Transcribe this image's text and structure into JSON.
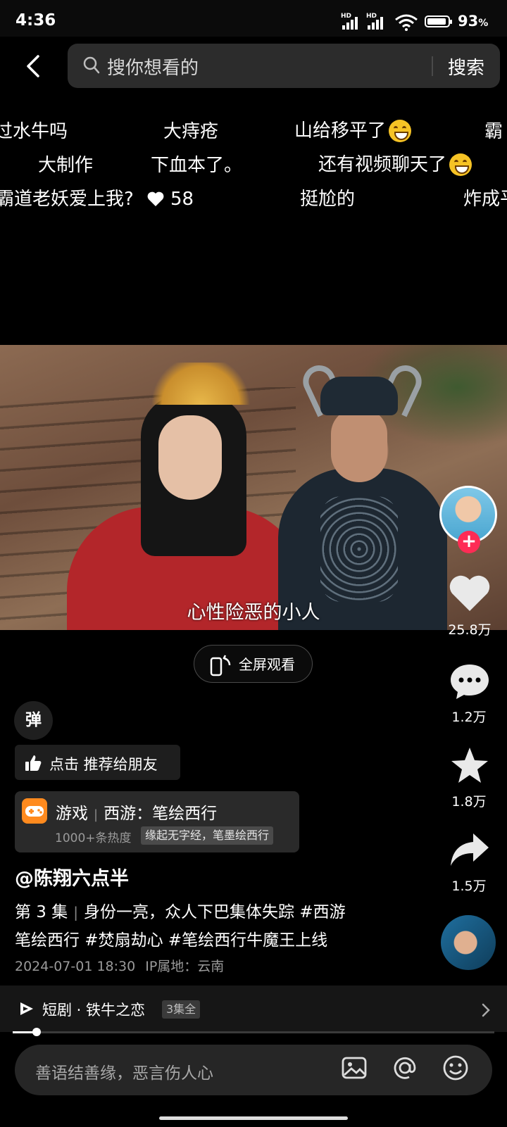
{
  "status_bar": {
    "time": "4:36",
    "battery": "93",
    "battery_level_percent": 93
  },
  "search": {
    "placeholder": "搜你想看的",
    "button": "搜索"
  },
  "danmaku": {
    "row1": [
      "过水牛吗",
      "大痔疮",
      "山给移平了",
      "霸"
    ],
    "row2": [
      "大制作",
      "下血本了。",
      "还有视频聊天了"
    ],
    "row3": [
      "霸道老妖爱上我?",
      "58",
      "挺尬的",
      "炸成平"
    ]
  },
  "video": {
    "subtitle": "心性险恶的小人",
    "fullscreen_label": "全屏观看"
  },
  "actions": {
    "like_count": "25.8万",
    "comment_count": "1.2万",
    "favorite_count": "1.8万",
    "share_count": "1.5万"
  },
  "danmu_toggle": "弹",
  "recommend_label": "点击 推荐给朋友",
  "game_card": {
    "category": "游戏",
    "title": "西游：笔绘西行",
    "heat": "1000+条热度",
    "tag": "缘起无字经，笔墨绘西行"
  },
  "post": {
    "author": "@陈翔六点半",
    "episode": "第 3 集",
    "desc_line1": "身份一亮，众人下巴集体失踪 #西游",
    "desc_line2": "笔绘西行  #焚扇劫心  #笔绘西行牛魔王上线",
    "date": "2024-07-01 18:30",
    "ip": "IP属地：云南"
  },
  "drama": {
    "label": "短剧 · 铁牛之恋",
    "badge": "3集全"
  },
  "playback": {
    "progress_fraction": 0.05
  },
  "comment": {
    "placeholder": "善语结善缘，恶言伤人心"
  },
  "colors": {
    "follow_red": "#fe2c55",
    "game_orange": "#ff8a1e"
  }
}
